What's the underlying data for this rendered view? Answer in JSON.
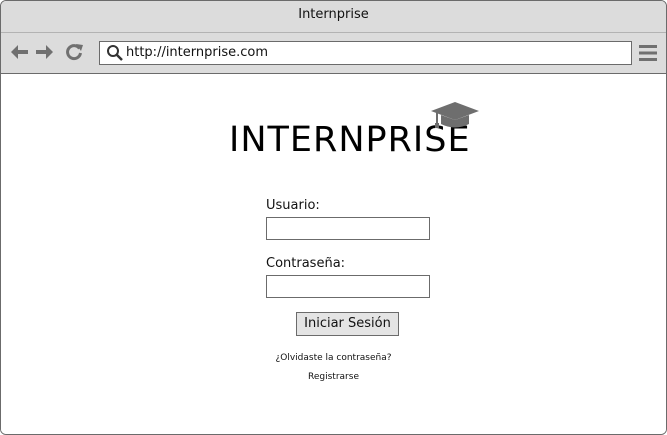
{
  "window": {
    "title": "Internprise"
  },
  "toolbar": {
    "back_icon": "back-arrow-icon",
    "forward_icon": "forward-arrow-icon",
    "reload_icon": "reload-icon",
    "url": "http://internprise.com",
    "search_icon": "search-icon",
    "menu_icon": "hamburger-menu-icon"
  },
  "login": {
    "logo_text": "INTERNPRISE",
    "logo_icon": "graduation-cap-icon",
    "username_label": "Usuario:",
    "username_value": "",
    "password_label": "Contraseña:",
    "password_value": "",
    "submit_label": "Iniciar Sesión",
    "forgot_label": "¿Olvidaste la contraseña?",
    "register_label": "Registrarse"
  },
  "colors": {
    "chrome": "#dcdcdc",
    "border": "#6b6b6b",
    "icon": "#707070",
    "button": "#e4e4e4"
  }
}
